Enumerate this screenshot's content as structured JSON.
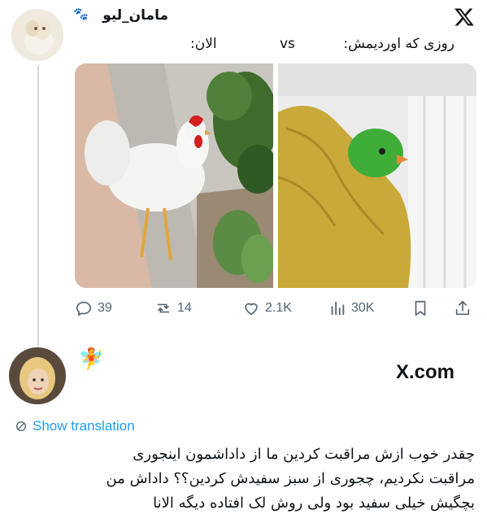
{
  "top_tweet": {
    "username": "مامان_لیو",
    "caption_before": "روزی که اوردیمش:",
    "caption_vs": "vs",
    "caption_now": "الان:",
    "stats": {
      "replies": "39",
      "retweets": "14",
      "likes": "2.1K",
      "views": "30K"
    },
    "images": [
      "white-rooster-photo",
      "green-chick-photo"
    ]
  },
  "bottom_tweet": {
    "brand": "X.com",
    "show_translation": "Show translation",
    "text_lines": [
      "چقدر خوب ازش مراقبت کردین ما از داداشمون اینجوری",
      "مراقبت نکردیم، چجوری از سبز سفیدش کردین؟؟ داداش من",
      "بچگیش خیلی سفید بود ولی روش لک افتاده دیگه الانا"
    ]
  },
  "icons": [
    "x-logo",
    "paw-icon",
    "reply-icon",
    "retweet-icon",
    "like-icon",
    "views-icon",
    "bookmark-icon",
    "share-icon",
    "fairy-icon",
    "translate-icon"
  ],
  "colors": {
    "link": "#1d9bf0",
    "muted": "#536471",
    "text": "#0f1419",
    "thread_line": "#cfd9de"
  }
}
